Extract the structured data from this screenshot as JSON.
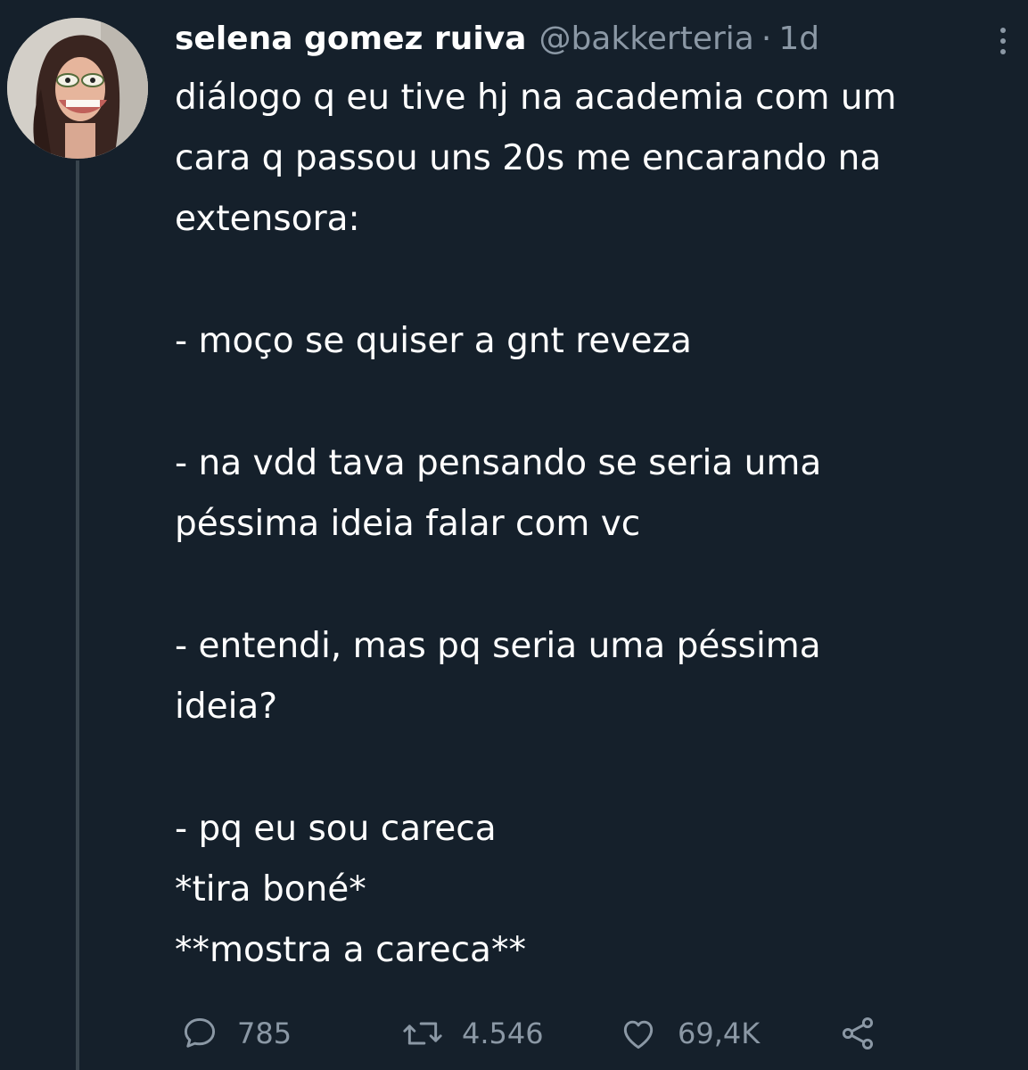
{
  "tweet": {
    "author_name": "selena gomez ruiva",
    "handle": "@bakkerteria",
    "separator": "·",
    "time": "1d",
    "paragraphs": [
      [
        "diálogo q eu tive hj na academia com um",
        "cara q passou uns 20s me encarando na",
        "extensora:"
      ],
      [
        "- moço se quiser a gnt reveza"
      ],
      [
        "- na vdd tava pensando se seria uma",
        "péssima ideia falar com vc"
      ],
      [
        "- entendi, mas pq seria uma péssima",
        "ideia?"
      ],
      [
        "- pq eu sou careca",
        "*tira boné*",
        "**mostra a careca**"
      ]
    ]
  },
  "actions": {
    "replies": "785",
    "retweets": "4.546",
    "likes": "69,4K"
  },
  "icons": {
    "reply": "speech-bubble-icon",
    "retweet": "retweet-icon",
    "like": "heart-icon",
    "share": "share-icon",
    "more": "vertical-ellipsis-icon"
  },
  "colors": {
    "background": "#15202b",
    "text": "#ffffff",
    "secondary": "#8b98a5"
  }
}
